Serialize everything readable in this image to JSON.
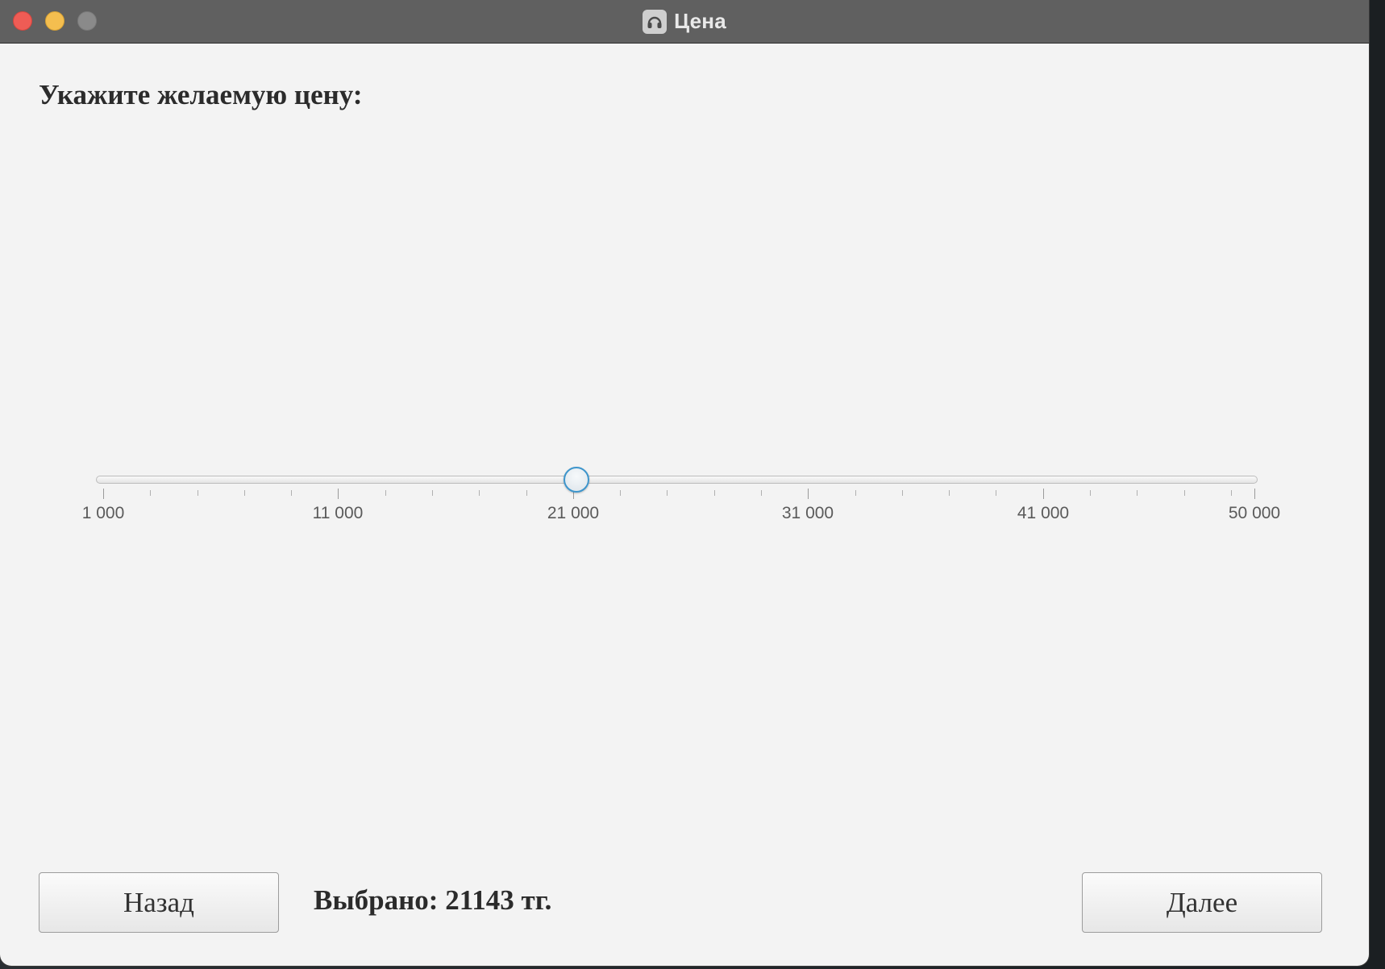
{
  "window": {
    "title": "Цена",
    "app_icon": "headphones-icon"
  },
  "prompt": "Укажите желаемую цену:",
  "slider": {
    "min": 1000,
    "max": 50000,
    "value": 21143,
    "tick_labels": [
      "1 000",
      "11 000",
      "21 000",
      "31 000",
      "41 000",
      "50 000"
    ],
    "accent_color": "#3d95cc"
  },
  "footer": {
    "back_label": "Назад",
    "selected_text": "Выбрано: 21143 тг.",
    "next_label": "Далее"
  },
  "colors": {
    "close": "#ee5c55",
    "minimize": "#f4be4f",
    "maximize": "#8a8a8a"
  }
}
